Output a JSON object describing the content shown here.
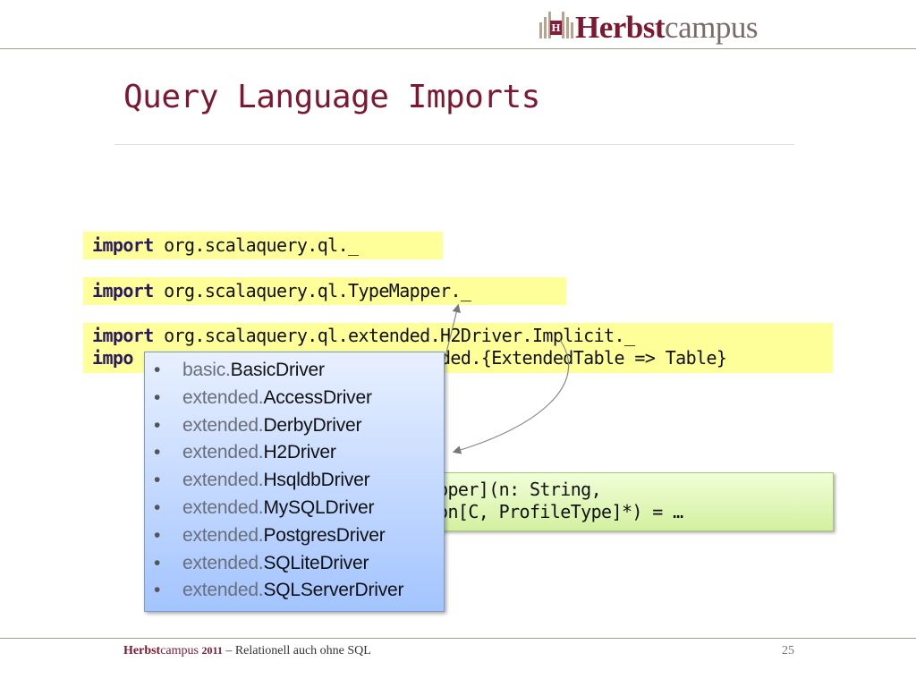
{
  "header": {
    "logo_h": "H",
    "logo_strong": "Herbst",
    "logo_light": "campus"
  },
  "slide": {
    "title": "Query Language Imports"
  },
  "code_lines": {
    "line1_kw": "import",
    "line1_rest": " org.scalaquery.ql._",
    "line2_kw": "import",
    "line2_rest": " org.scalaquery.ql.TypeMapper._",
    "line3_kw": "import",
    "line3_rest": " org.scalaquery.ql.extended.H2Driver.Implicit._",
    "line4_kw": "impo",
    "line4_rest": "                            ended.{ExtendedTable => Table}"
  },
  "definition": {
    "line1": "pper](n: String,",
    "line2": "on[C, ProfileType]*) = …"
  },
  "drivers": [
    {
      "prefix": "basic.",
      "name": "BasicDriver"
    },
    {
      "prefix": "extended.",
      "name": "AccessDriver"
    },
    {
      "prefix": "extended.",
      "name": "DerbyDriver"
    },
    {
      "prefix": "extended.",
      "name": "H2Driver"
    },
    {
      "prefix": "extended.",
      "name": "HsqldbDriver"
    },
    {
      "prefix": "extended.",
      "name": "MySQLDriver"
    },
    {
      "prefix": "extended.",
      "name": "PostgresDriver"
    },
    {
      "prefix": "extended.",
      "name": "SQLiteDriver"
    },
    {
      "prefix": "extended.",
      "name": "SQLServerDriver"
    }
  ],
  "footer": {
    "brand_strong": "Herbst",
    "brand_light": "campus",
    "year": "2011",
    "subtitle": " – Relationell auch ohne SQL",
    "page_number": "25"
  },
  "colors": {
    "accent": "#7d1833",
    "code_highlight": "#ffff99",
    "definition_box": "#d4f0a0",
    "driver_box": "#a3c4ff"
  }
}
